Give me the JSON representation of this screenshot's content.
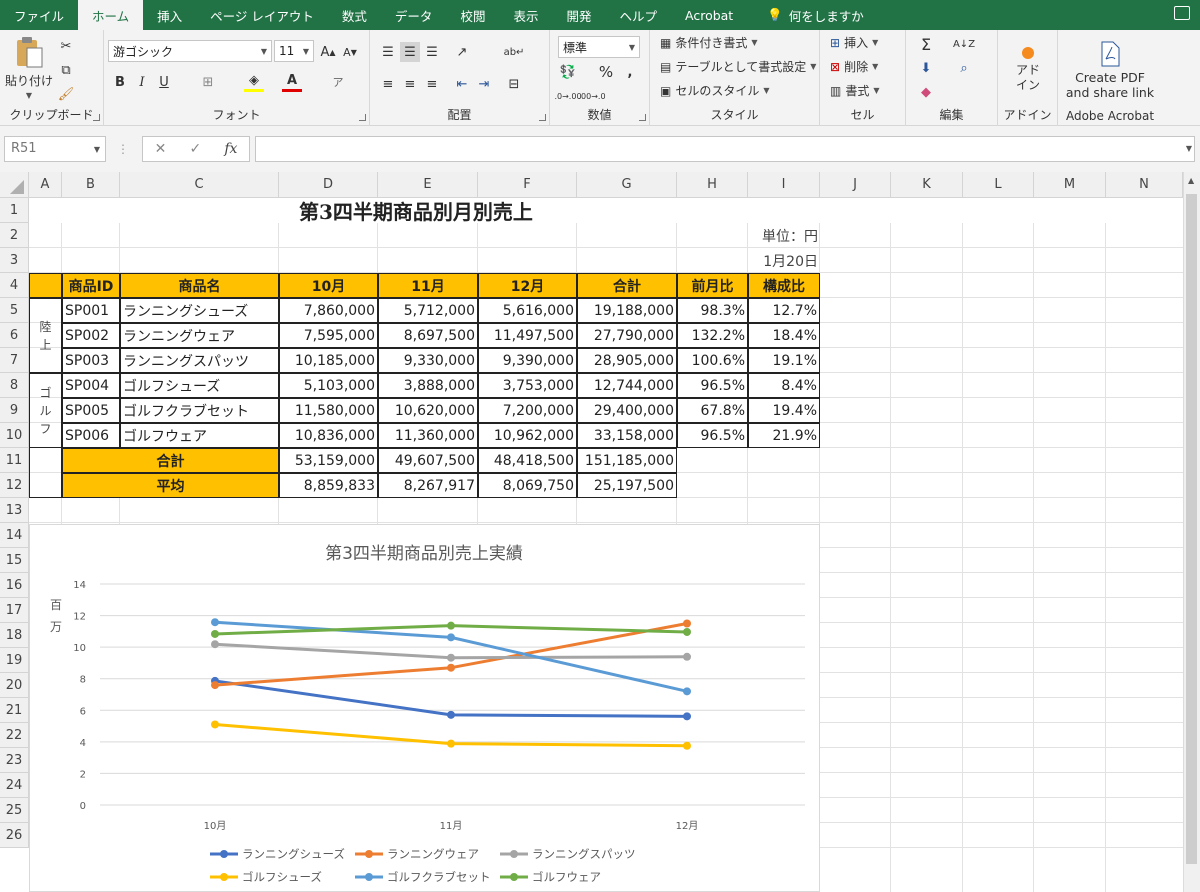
{
  "ribbon_tabs": [
    "ファイル",
    "ホーム",
    "挿入",
    "ページ レイアウト",
    "数式",
    "データ",
    "校閲",
    "表示",
    "開発",
    "ヘルプ",
    "Acrobat"
  ],
  "tell_me": "何をしますか",
  "ribbon": {
    "clipboard": {
      "paste": "貼り付け",
      "label": "クリップボード"
    },
    "font": {
      "name": "游ゴシック",
      "size": "11",
      "label": "フォント",
      "bold": "B",
      "italic": "I",
      "underline": "U"
    },
    "alignment": {
      "label": "配置"
    },
    "number": {
      "format": "標準",
      "label": "数値",
      "percent": "%",
      "comma": ","
    },
    "styles": {
      "conditional": "条件付き書式",
      "table": "テーブルとして書式設定",
      "cell_styles": "セルのスタイル",
      "label": "スタイル"
    },
    "cells": {
      "insert": "挿入",
      "delete": "削除",
      "format": "書式",
      "label": "セル"
    },
    "editing": {
      "label": "編集",
      "sum": "Σ"
    },
    "addins": {
      "button": "アド\nイン",
      "label": "アドイン"
    },
    "adobe": {
      "button": "Create PDF and share link",
      "label": "Adobe Acrobat"
    }
  },
  "formula_bar": {
    "name_box": "R51",
    "fx": "fx",
    "value": ""
  },
  "columns": [
    "A",
    "B",
    "C",
    "D",
    "E",
    "F",
    "G",
    "H",
    "I",
    "J",
    "K",
    "L",
    "M",
    "N"
  ],
  "rows": [
    "1",
    "2",
    "3",
    "4",
    "5",
    "6",
    "7",
    "8",
    "9",
    "10",
    "11",
    "12",
    "13",
    "14",
    "15",
    "16",
    "17",
    "18",
    "19",
    "20",
    "21",
    "22",
    "23",
    "24",
    "25",
    "26"
  ],
  "sheet": {
    "title": "第3四半期商品別月別売上",
    "unit": "単位：円",
    "date": "1月20日",
    "headers": [
      "商品ID",
      "商品名",
      "10月",
      "11月",
      "12月",
      "合計",
      "前月比",
      "構成比"
    ],
    "group_a": [
      "陸",
      "上"
    ],
    "group_b": [
      "ゴ",
      "ル",
      "フ"
    ],
    "rows": [
      [
        "SP001",
        "ランニングシューズ",
        "7,860,000",
        "5,712,000",
        "5,616,000",
        "19,188,000",
        "98.3%",
        "12.7%"
      ],
      [
        "SP002",
        "ランニングウェア",
        "7,595,000",
        "8,697,500",
        "11,497,500",
        "27,790,000",
        "132.2%",
        "18.4%"
      ],
      [
        "SP003",
        "ランニングスパッツ",
        "10,185,000",
        "9,330,000",
        "9,390,000",
        "28,905,000",
        "100.6%",
        "19.1%"
      ],
      [
        "SP004",
        "ゴルフシューズ",
        "5,103,000",
        "3,888,000",
        "3,753,000",
        "12,744,000",
        "96.5%",
        "8.4%"
      ],
      [
        "SP005",
        "ゴルフクラブセット",
        "11,580,000",
        "10,620,000",
        "7,200,000",
        "29,400,000",
        "67.8%",
        "19.4%"
      ],
      [
        "SP006",
        "ゴルフウェア",
        "10,836,000",
        "11,360,000",
        "10,962,000",
        "33,158,000",
        "96.5%",
        "21.9%"
      ]
    ],
    "total_label": "合計",
    "total": [
      "53,159,000",
      "49,607,500",
      "48,418,500",
      "151,185,000"
    ],
    "avg_label": "平均",
    "avg": [
      "8,859,833",
      "8,267,917",
      "8,069,750",
      "25,197,500"
    ]
  },
  "chart_data": {
    "type": "line",
    "title": "第3四半期商品別売上実績",
    "ylabel": "百万",
    "categories": [
      "10月",
      "11月",
      "12月"
    ],
    "ylim": [
      0,
      14
    ],
    "yticks": [
      0,
      2,
      4,
      6,
      8,
      10,
      12,
      14
    ],
    "grid": true,
    "legend": "bottom",
    "series": [
      {
        "name": "ランニングシューズ",
        "color": "#4472c4",
        "values": [
          7.86,
          5.712,
          5.616
        ]
      },
      {
        "name": "ランニングウェア",
        "color": "#ed7d31",
        "values": [
          7.595,
          8.6975,
          11.4975
        ]
      },
      {
        "name": "ランニングスパッツ",
        "color": "#a5a5a5",
        "values": [
          10.185,
          9.33,
          9.39
        ]
      },
      {
        "name": "ゴルフシューズ",
        "color": "#ffc000",
        "values": [
          5.103,
          3.888,
          3.753
        ]
      },
      {
        "name": "ゴルフクラブセット",
        "color": "#5b9bd5",
        "values": [
          11.58,
          10.62,
          7.2
        ]
      },
      {
        "name": "ゴルフウェア",
        "color": "#70ad47",
        "values": [
          10.836,
          11.36,
          10.962
        ]
      }
    ]
  }
}
